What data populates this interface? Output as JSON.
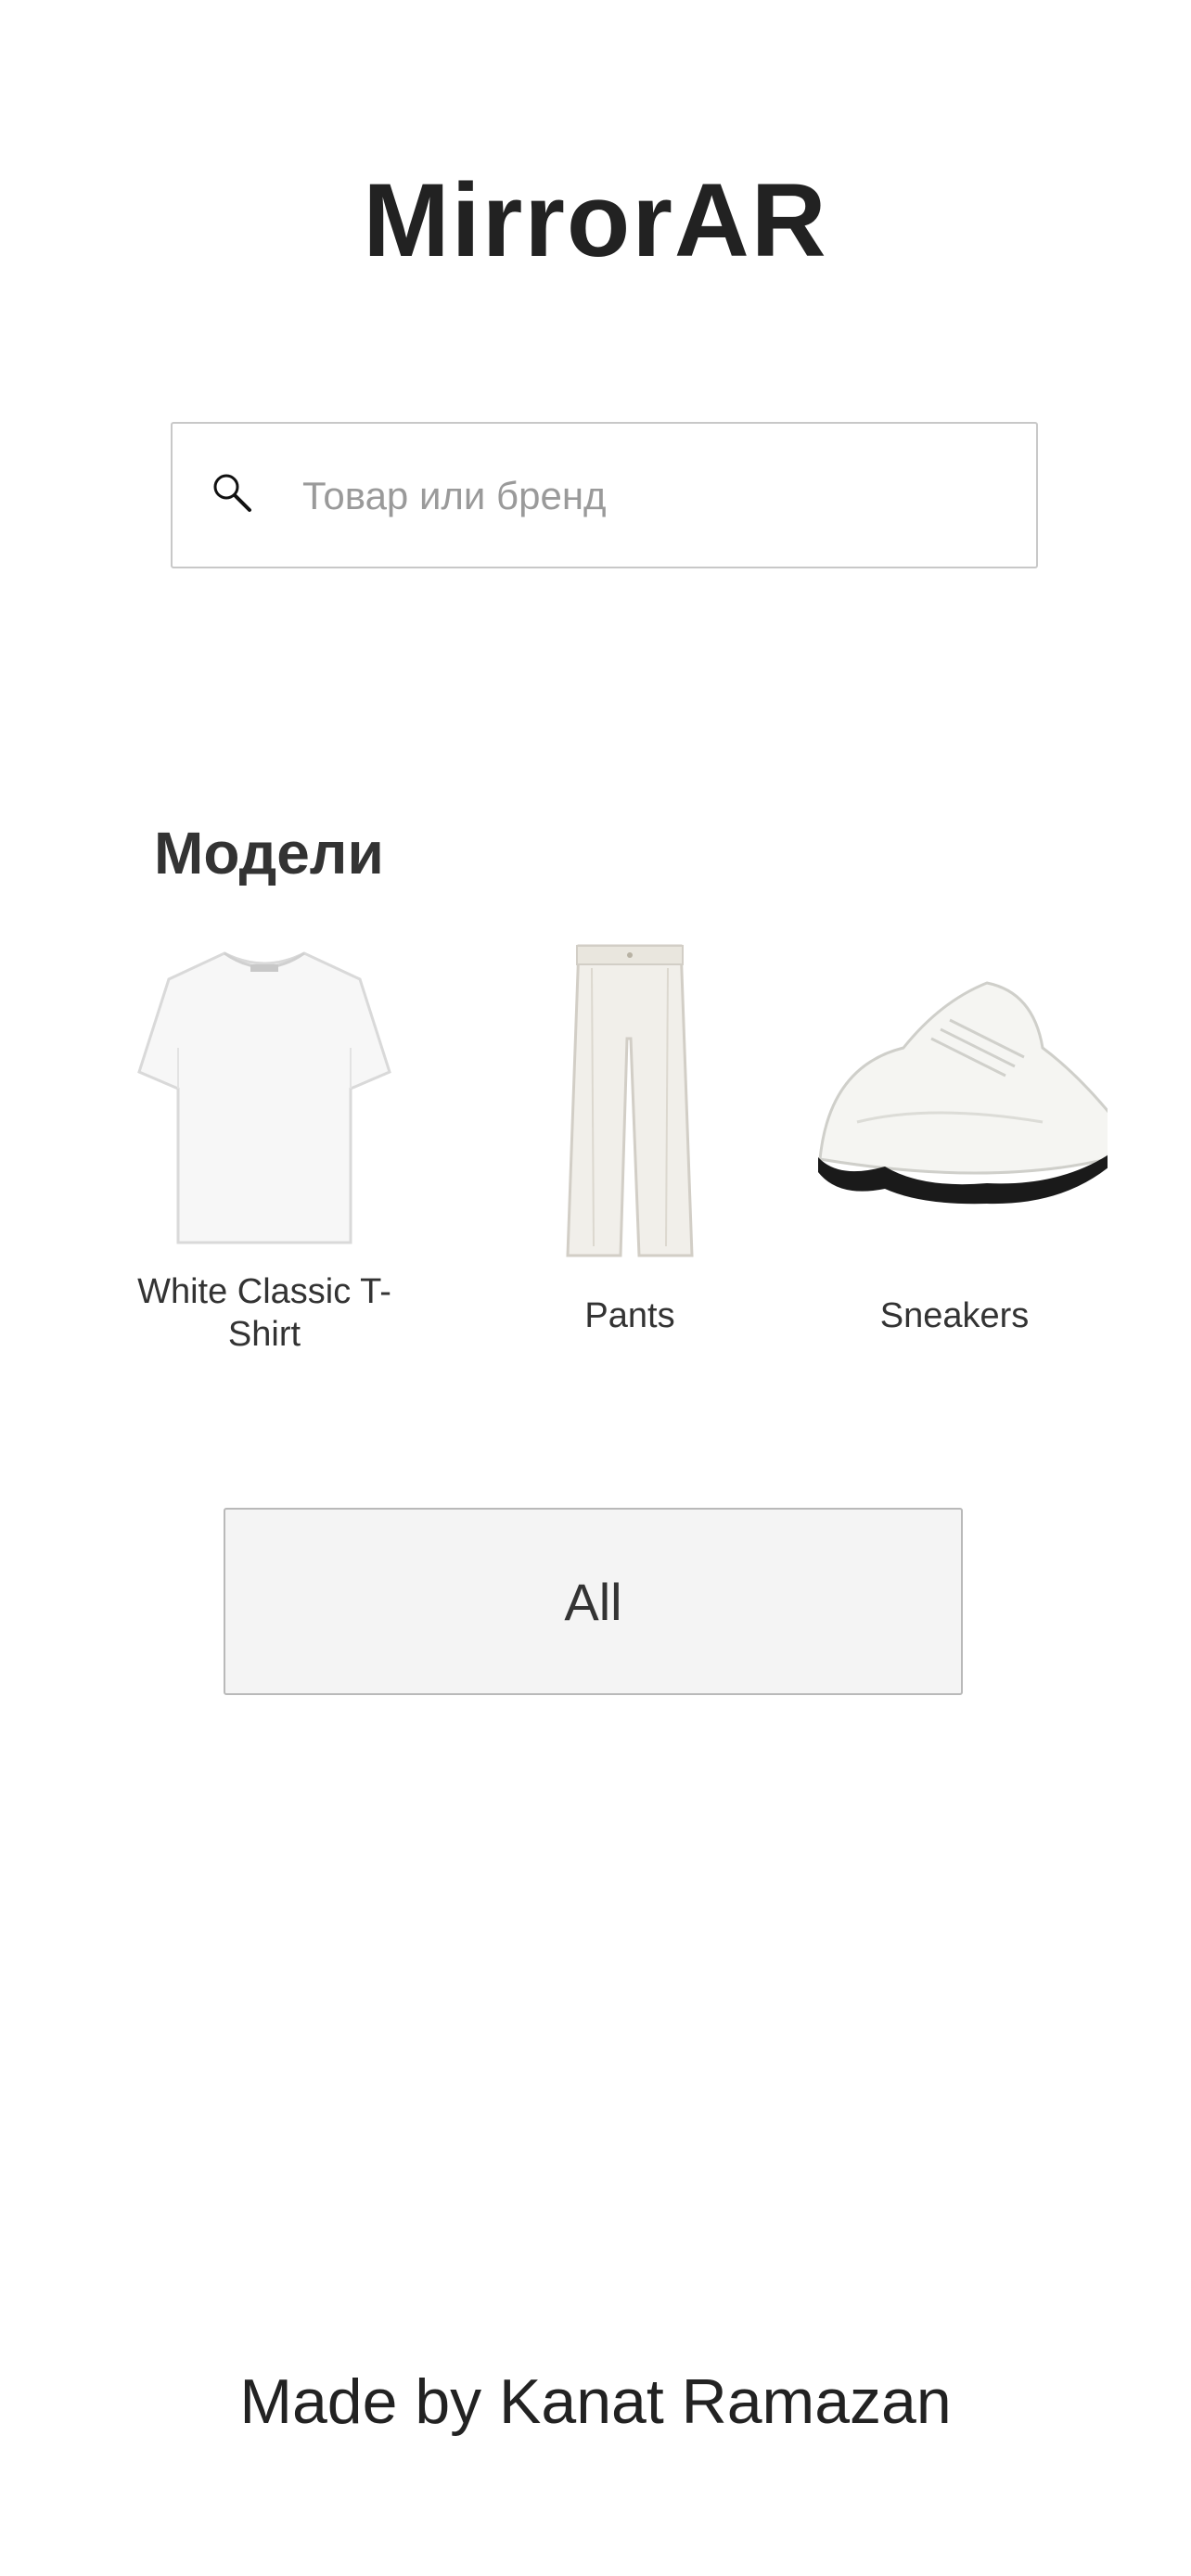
{
  "app": {
    "title": "MirrorAR"
  },
  "search": {
    "placeholder": "Товар или бренд",
    "value": "",
    "icon": "search-icon"
  },
  "models": {
    "title": "Модели",
    "items": [
      {
        "label": "White Classic T-Shirt",
        "icon": "t-shirt-image"
      },
      {
        "label": "Pants",
        "icon": "pants-image"
      },
      {
        "label": "Sneakers",
        "icon": "sneakers-image"
      }
    ]
  },
  "actions": {
    "all_label": "All"
  },
  "footer": {
    "credit": "Made by Kanat Ramazan"
  },
  "colors": {
    "text": "#222222",
    "button_bg": "#f4f4f4",
    "border": "#c8c8c8",
    "placeholder": "#9a9a9a"
  }
}
